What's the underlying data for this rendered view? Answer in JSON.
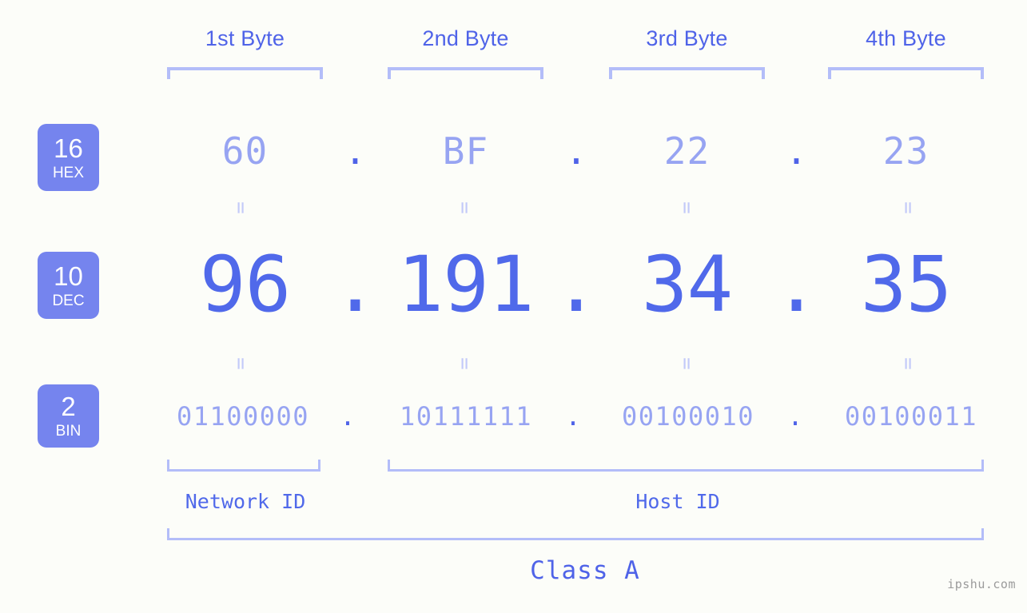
{
  "header": {
    "byte_labels": [
      "1st Byte",
      "2nd Byte",
      "3rd Byte",
      "4th Byte"
    ]
  },
  "radix_badges": [
    {
      "num": "16",
      "unit": "HEX"
    },
    {
      "num": "10",
      "unit": "DEC"
    },
    {
      "num": "2",
      "unit": "BIN"
    }
  ],
  "rows": {
    "hex": {
      "values": [
        "60",
        "BF",
        "22",
        "23"
      ],
      "separator": "."
    },
    "dec": {
      "values": [
        "96",
        "191",
        "34",
        "35"
      ],
      "separator": "."
    },
    "bin": {
      "values": [
        "01100000",
        "10111111",
        "00100010",
        "00100011"
      ],
      "separator": "."
    }
  },
  "equals_marks": {
    "symbol": "=",
    "count_per_row": 4
  },
  "footer": {
    "network_id_label": "Network ID",
    "host_id_label": "Host ID",
    "class_label": "Class A",
    "watermark": "ipshu.com"
  },
  "colors": {
    "background": "#fcfdf9",
    "accent_strong": "#4f63e8",
    "accent_mid": "#5069ea",
    "accent_light": "#97a4f2",
    "bracket": "#b3bdf9",
    "badge_bg": "#7584ee",
    "badge_text": "#ffffff",
    "watermark_text": "#9b9b9b"
  }
}
